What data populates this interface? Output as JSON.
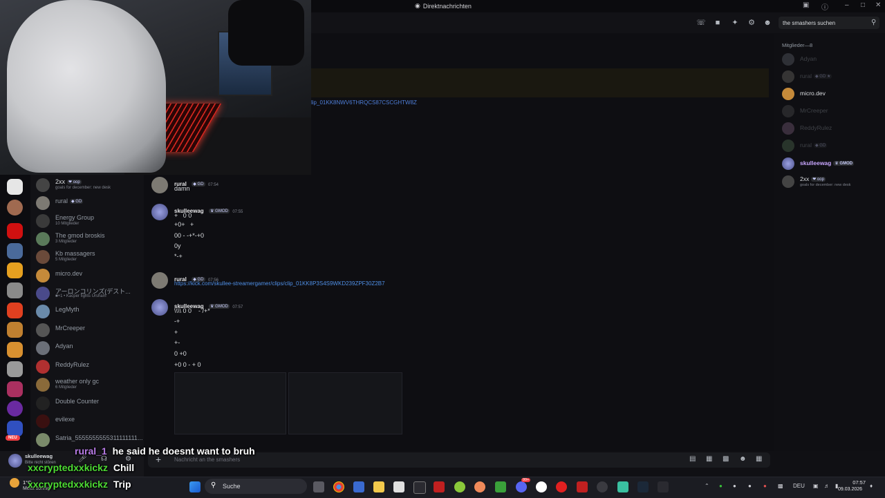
{
  "window": {
    "title": "Direktnachrichten"
  },
  "search": {
    "value": "the smashers suchen"
  },
  "top_link": "lip_01KK8NWV6THRQCS87CSCGHTW8Z",
  "dm_list": [
    {
      "name": "2xx",
      "tag": "❤ oop",
      "sub": "goals for december: new desk"
    },
    {
      "name": "rural",
      "tag": "◆ GD",
      "sub": ""
    },
    {
      "name": "Energy Group",
      "sub": "10 Mitglieder"
    },
    {
      "name": "The gmod broskis",
      "sub": "3 Mitglieder"
    },
    {
      "name": "Kb massagers",
      "sub": "5 Mitglieder"
    },
    {
      "name": "micro.dev",
      "sub": ""
    },
    {
      "name": "アーロンコリンズ(デスト...",
      "sub": "■+1 • Kacper fights Ursham"
    },
    {
      "name": "LegMyth",
      "sub": ""
    },
    {
      "name": "MrCreeper",
      "sub": ""
    },
    {
      "name": "Adyan",
      "sub": ""
    },
    {
      "name": "ReddyRulez",
      "sub": ""
    },
    {
      "name": "weather only gc",
      "sub": "6 Mitglieder"
    },
    {
      "name": "Double Counter",
      "sub": ""
    },
    {
      "name": "evilexe",
      "sub": ""
    },
    {
      "name": "Satria_5555555555311111111...",
      "sub": ""
    }
  ],
  "messages": [
    {
      "author": "rural",
      "tag": "◆ GD",
      "time": "07:54",
      "lines": [
        "damn"
      ]
    },
    {
      "author": "skulleewag",
      "tag": "♛ GMOD",
      "time": "07:55",
      "lines": [
        "+   0 0",
        "+0+   +",
        "00 - -+*-+0",
        "0y",
        "*-+"
      ]
    },
    {
      "author": "rural",
      "tag": "◆ GD",
      "time": "07:56",
      "link": "https://kick.com/skullee-streamergamer/clips/clip_01KK8P3S4S9WKD239ZPF30Z2B7"
    },
    {
      "author": "skulleewag",
      "tag": "♛ GMOD",
      "time": "07:57",
      "lines": [
        "\\\\\\\\ 0 0    - /+*",
        "-+",
        "+",
        "+-",
        "0 +0",
        "+0 0 - + 0"
      ]
    }
  ],
  "members": {
    "header": "Mitglieder—8",
    "list": [
      {
        "name": "Adyan",
        "tag": "",
        "sub": "",
        "online": false
      },
      {
        "name": "rural",
        "tag": "◆ GD ★",
        "sub": "",
        "online": false
      },
      {
        "name": "micro.dev",
        "tag": "",
        "sub": "",
        "online": true
      },
      {
        "name": "MrCreeper",
        "tag": "",
        "sub": "",
        "online": false
      },
      {
        "name": "ReddyRulez",
        "tag": "",
        "sub": "",
        "online": false
      },
      {
        "name": "rural",
        "tag": "◆ GD",
        "sub": "",
        "online": false
      },
      {
        "name": "skulleewag",
        "tag": "♛ GMOD",
        "sub": "",
        "online": true,
        "highlight": true
      },
      {
        "name": "2xx",
        "tag": "❤ oop",
        "sub": "goals for december: new desk",
        "online": true
      }
    ]
  },
  "user_panel": {
    "name": "skulleewag",
    "status": "Bitte nicht stören"
  },
  "composer": {
    "placeholder": "Nachricht an the smashers"
  },
  "overlay_chat": [
    {
      "user": "rural_1",
      "text": "he said he doesnt want to bruh",
      "color": "#b87be6"
    },
    {
      "user": "xxcryptedxxkickz",
      "text": "Chill",
      "color": "#4ddb33"
    },
    {
      "user": "xxcryptedxxkickz",
      "text": "Trip",
      "color": "#4ddb33"
    }
  ],
  "weather": {
    "temp": "1°C",
    "desc": "Meist sonnig"
  },
  "taskbar": {
    "search_label": "Suche",
    "lang": "DEU",
    "time": "07:57",
    "date": "09.03.2026",
    "badge": "99+"
  },
  "rail_badge": "NEU",
  "colors": {
    "accent": "#5865f2",
    "link": "#4f8fe6",
    "dnd": "#f23f43",
    "online": "#23a559"
  }
}
